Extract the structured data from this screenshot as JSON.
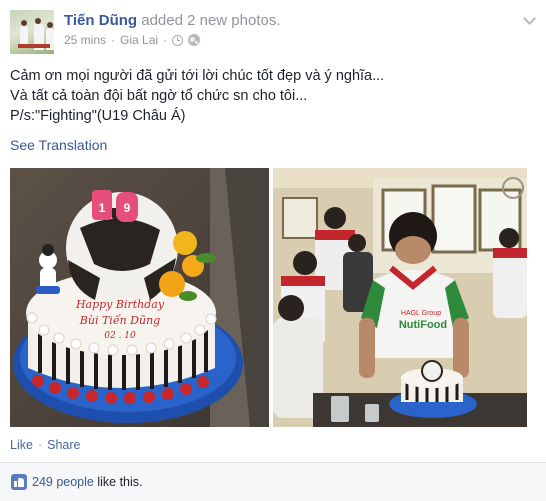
{
  "post": {
    "author": "Tiến Dũng",
    "action": "added 2 new photos.",
    "time": "25 mins",
    "separator": "·",
    "location": "Gia Lai",
    "separator2": "·",
    "message_lines": [
      "Cảm ơn mọi người đã gửi tới lời chúc tốt đẹp và ý nghĩa...",
      "Và tất cả toàn đội bất ngờ tổ chức sn cho tôi...",
      "P/s:\"Fighting\"(U19 Châu Á)"
    ],
    "see_translation": "See Translation",
    "cake_text": {
      "line1": "Happy Birthday",
      "line2": "Bùi Tiến Dũng",
      "line3": "02 . 10",
      "candles": "19"
    },
    "shirt_text": {
      "line1": "HAGL Group",
      "line2": "NutiFood"
    },
    "actions": {
      "like": "Like",
      "dot": "·",
      "share": "Share"
    },
    "likes": {
      "count_text": "249 people",
      "suffix": " like this."
    }
  },
  "icons": [
    "clock-icon",
    "globe-icon",
    "chevron-down-icon",
    "like-thumb-icon"
  ],
  "colors": {
    "link": "#3b5998",
    "meta": "#90949c",
    "likes_bar": "#f6f7f9"
  }
}
